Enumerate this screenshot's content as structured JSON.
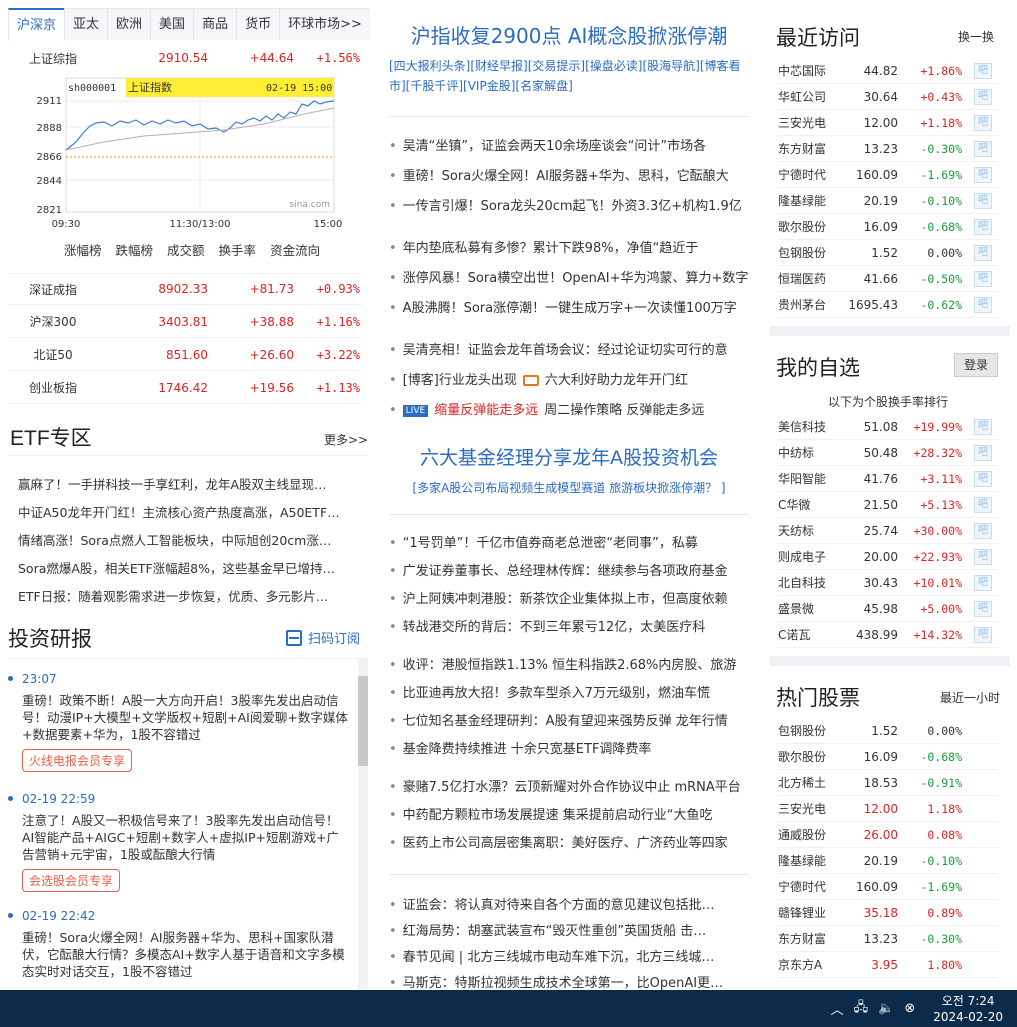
{
  "left": {
    "tabs": [
      "沪深京",
      "亚太",
      "欧洲",
      "美国",
      "商品",
      "货币",
      "环球市场>>"
    ],
    "top_index": {
      "name": "上证综指",
      "value": "2910.54",
      "change": "+44.64",
      "pct": "+1.56%"
    },
    "chart": {
      "code": "sh000001",
      "name": "上证指数",
      "time": "02-19 15:00",
      "yticks": [
        "2911",
        "2888",
        "2866",
        "2844",
        "2821"
      ],
      "xticks": [
        "09:30",
        "11:30/13:00",
        "15:00"
      ],
      "watermark": "sina.com"
    },
    "chart_links": [
      "涨幅榜",
      "跌幅榜",
      "成交额",
      "换手率",
      "资金流向"
    ],
    "indices": [
      {
        "name": "深证成指",
        "value": "8902.33",
        "change": "+81.73",
        "pct": "+0.93%"
      },
      {
        "name": "沪深300",
        "value": "3403.81",
        "change": "+38.88",
        "pct": "+1.16%"
      },
      {
        "name": "北证50",
        "value": "851.60",
        "change": "+26.60",
        "pct": "+3.22%"
      },
      {
        "name": "创业板指",
        "value": "1746.42",
        "change": "+19.56",
        "pct": "+1.13%"
      }
    ],
    "etf": {
      "title": "ETF专区",
      "more": "更多>>",
      "items": [
        "赢麻了！一手拼科技一手享红利，龙年A股双主线显现…",
        "中证A50龙年开门红！主流核心资产热度高涨，A50ETF…",
        "情绪高涨！Sora点燃人工智能板块，中际旭创20cm涨…",
        "Sora燃爆A股，相关ETF涨幅超8%，这些基金早已增持…",
        "ETF日报：随着观影需求进一步恢复，优质、多元影片…"
      ]
    },
    "research": {
      "title": "投资研报",
      "subscribe": "扫码订阅",
      "items": [
        {
          "time": "23:07",
          "text": "重磅！政策不断！A股一大方向开启！3股率先发出启动信号！动漫IP+大模型+文学版权+短剧+AI阅爱聊+数字媒体+数据要素+华为，1股不容错过",
          "badge": "火线电报会员专享"
        },
        {
          "time": "02-19 22:59",
          "text": "注意了！A股又一积极信号来了！3股率先发出启动信号！AI智能产品+AIGC+短剧+数字人+虚拟IP+短剧游戏+广告营销+元宇宙，1股或酝酿大行情",
          "badge": "会选股会员专享"
        },
        {
          "time": "02-19 22:42",
          "text": "重磅！Sora火爆全网！AI服务器+华为、思科+国家队潜伏，它酝酿大行情？多模态AI+数字人基于语音和文字多模态实时对话交互，1股不容错过",
          "badge": ""
        }
      ]
    }
  },
  "mid": {
    "headline1": "沪指收复2900点 AI概念股掀涨停潮",
    "tags1": "[四大报利头条][财经早报][交易提示][操盘必读][股海导航][博客看市][千股千评][VIP金股][名家解盘]",
    "group1": [
      "吴清“坐镇”，证监会两天10余场座谈会“问计”市场各",
      "重磅！Sora火爆全网！AI服务器+华为、思科，它酝酿大",
      "一传言引爆！Sora龙头20cm起飞！外资3.3亿+机构1.9亿"
    ],
    "group2": [
      "年内垫底私募有多惨？累计下跌98%，净值“趋近于",
      "涨停风暴！Sora横空出世！OpenAI+华为鸿蒙、算力+数字",
      "A股沸腾！Sora涨停潮！一键生成万字+一次读懂100万字"
    ],
    "group3": [
      "吴清亮相！证监会龙年首场会议：经过论证切实可行的意",
      "[博客]行业龙头出现",
      "六大利好助力龙年开门红"
    ],
    "live_label": "LIVE",
    "live_red": "缩量反弹能走多远",
    "live_rest": "周二操作策略 反弹能走多远",
    "headline2": "六大基金经理分享龙年A股投资机会",
    "tags2": "[多家A股公司布局视频生成模型赛道 旅游板块掀涨停潮？ ]",
    "group4": [
      "“1号罚单”！千亿市值券商老总泄密“老同事”，私募",
      "广发证券董事长、总经理林传辉：继续参与各项政府基金",
      "沪上阿姨冲刺港股：新茶饮企业集体拟上市，但高度依赖",
      "转战港交所的背后：不到三年累亏12亿，太美医疗科"
    ],
    "group5": [
      "收评：港股恒指跌1.13% 恒生科指跌2.68%内房股、旅游",
      "比亚迪再放大招！多款车型杀入7万元级别，燃油车慌",
      "七位知名基金经理研判：A股有望迎来强势反弹 龙年行情",
      "基金降费持续推进 十余只宽基ETF调降费率"
    ],
    "group6": [
      "豪赌7.5亿打水漂？云顶新耀对外合作协议中止 mRNA平台",
      "中药配方颗粒市场发展提速 集采提前启动行业“大鱼吃",
      "医药上市公司高层密集离职：美好医疗、广济药业等四家"
    ],
    "group7": [
      "证监会：将认真对待来自各个方面的意见建议包括批…",
      "红海局势：胡塞武装宣布“毁灭性重创”英国货船 击…",
      "春节见闻 | 北方三线城市电动车难下沉，北方三线城…",
      "马斯克：特斯拉视频生成技术全球第一，比OpenAI更…"
    ]
  },
  "right": {
    "recent": {
      "title": "最近访问",
      "action": "换一换",
      "bar_label": "吧",
      "items": [
        {
          "name": "中芯国际",
          "price": "44.82",
          "pct": "+1.86%",
          "dir": "up"
        },
        {
          "name": "华虹公司",
          "price": "30.64",
          "pct": "+0.43%",
          "dir": "up"
        },
        {
          "name": "三安光电",
          "price": "12.00",
          "pct": "+1.18%",
          "dir": "up"
        },
        {
          "name": "东方财富",
          "price": "13.23",
          "pct": "-0.30%",
          "dir": "dn"
        },
        {
          "name": "宁德时代",
          "price": "160.09",
          "pct": "-1.69%",
          "dir": "dn"
        },
        {
          "name": "隆基绿能",
          "price": "20.19",
          "pct": "-0.10%",
          "dir": "dn"
        },
        {
          "name": "歌尔股份",
          "price": "16.09",
          "pct": "-0.68%",
          "dir": "dn"
        },
        {
          "name": "包钢股份",
          "price": "1.52",
          "pct": "0.00%",
          "dir": "flat"
        },
        {
          "name": "恒瑞医药",
          "price": "41.66",
          "pct": "-0.50%",
          "dir": "dn"
        },
        {
          "name": "贵州茅台",
          "price": "1695.43",
          "pct": "-0.62%",
          "dir": "dn"
        }
      ]
    },
    "watch": {
      "title": "我的自选",
      "login": "登录",
      "subtitle": "以下为个股换手率排行",
      "items": [
        {
          "name": "美信科技",
          "price": "51.08",
          "pct": "+19.99%",
          "dir": "up"
        },
        {
          "name": "中纺标",
          "price": "50.48",
          "pct": "+28.32%",
          "dir": "up"
        },
        {
          "name": "华阳智能",
          "price": "41.76",
          "pct": "+3.11%",
          "dir": "up"
        },
        {
          "name": "C华微",
          "price": "21.50",
          "pct": "+5.13%",
          "dir": "up"
        },
        {
          "name": "天纺标",
          "price": "25.74",
          "pct": "+30.00%",
          "dir": "up"
        },
        {
          "name": "则成电子",
          "price": "20.00",
          "pct": "+22.93%",
          "dir": "up"
        },
        {
          "name": "北自科技",
          "price": "30.43",
          "pct": "+10.01%",
          "dir": "up"
        },
        {
          "name": "盛景微",
          "price": "45.98",
          "pct": "+5.00%",
          "dir": "up"
        },
        {
          "name": "C诺瓦",
          "price": "438.99",
          "pct": "+14.32%",
          "dir": "up"
        }
      ]
    },
    "hot": {
      "title": "热门股票",
      "period": "最近一小时",
      "items": [
        {
          "name": "包钢股份",
          "price": "1.52",
          "pct": "0.00%",
          "dir": "flat"
        },
        {
          "name": "歌尔股份",
          "price": "16.09",
          "pct": "-0.68%",
          "dir": "dn"
        },
        {
          "name": "北方稀土",
          "price": "18.53",
          "pct": "-0.91%",
          "dir": "dn"
        },
        {
          "name": "三安光电",
          "price": "12.00",
          "pct": "1.18%",
          "dir": "up"
        },
        {
          "name": "通威股份",
          "price": "26.00",
          "pct": "0.08%",
          "dir": "up"
        },
        {
          "name": "隆基绿能",
          "price": "20.19",
          "pct": "-0.10%",
          "dir": "dn"
        },
        {
          "name": "宁德时代",
          "price": "160.09",
          "pct": "-1.69%",
          "dir": "dn"
        },
        {
          "name": "赣锋锂业",
          "price": "35.18",
          "pct": "0.89%",
          "dir": "up"
        },
        {
          "name": "东方财富",
          "price": "13.23",
          "pct": "-0.30%",
          "dir": "dn"
        },
        {
          "name": "京东方A",
          "price": "3.95",
          "pct": "1.80%",
          "dir": "up"
        }
      ]
    }
  },
  "taskbar": {
    "time": "오전 7:24",
    "date": "2024-02-20"
  },
  "colors": {
    "accent": "#2a6cc2",
    "up": "#dd2222",
    "down": "#1a9a3a",
    "taskbar": "#0c2a4a"
  }
}
